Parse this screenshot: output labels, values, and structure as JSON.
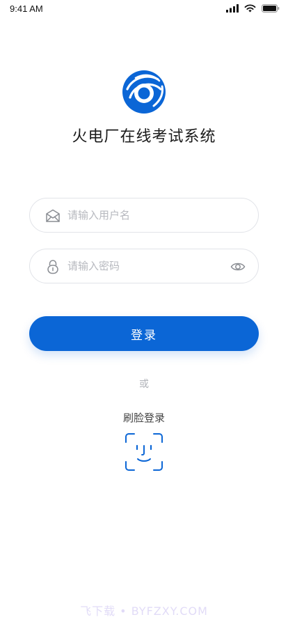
{
  "status_bar": {
    "time": "9:41 AM"
  },
  "app": {
    "title": "火电厂在线考试系统",
    "brand_color": "#0b66d6"
  },
  "form": {
    "username": {
      "placeholder": "请输入用户名",
      "value": "",
      "icon": "envelope-icon"
    },
    "password": {
      "placeholder": "请输入密码",
      "value": "",
      "icon": "lock-icon",
      "toggle_icon": "eye-icon"
    },
    "login_label": "登录"
  },
  "alt_login": {
    "or_text": "或",
    "face_login_label": "刷脸登录",
    "icon": "face-id-icon"
  },
  "watermark": "飞下载 • BYFZXY.COM"
}
